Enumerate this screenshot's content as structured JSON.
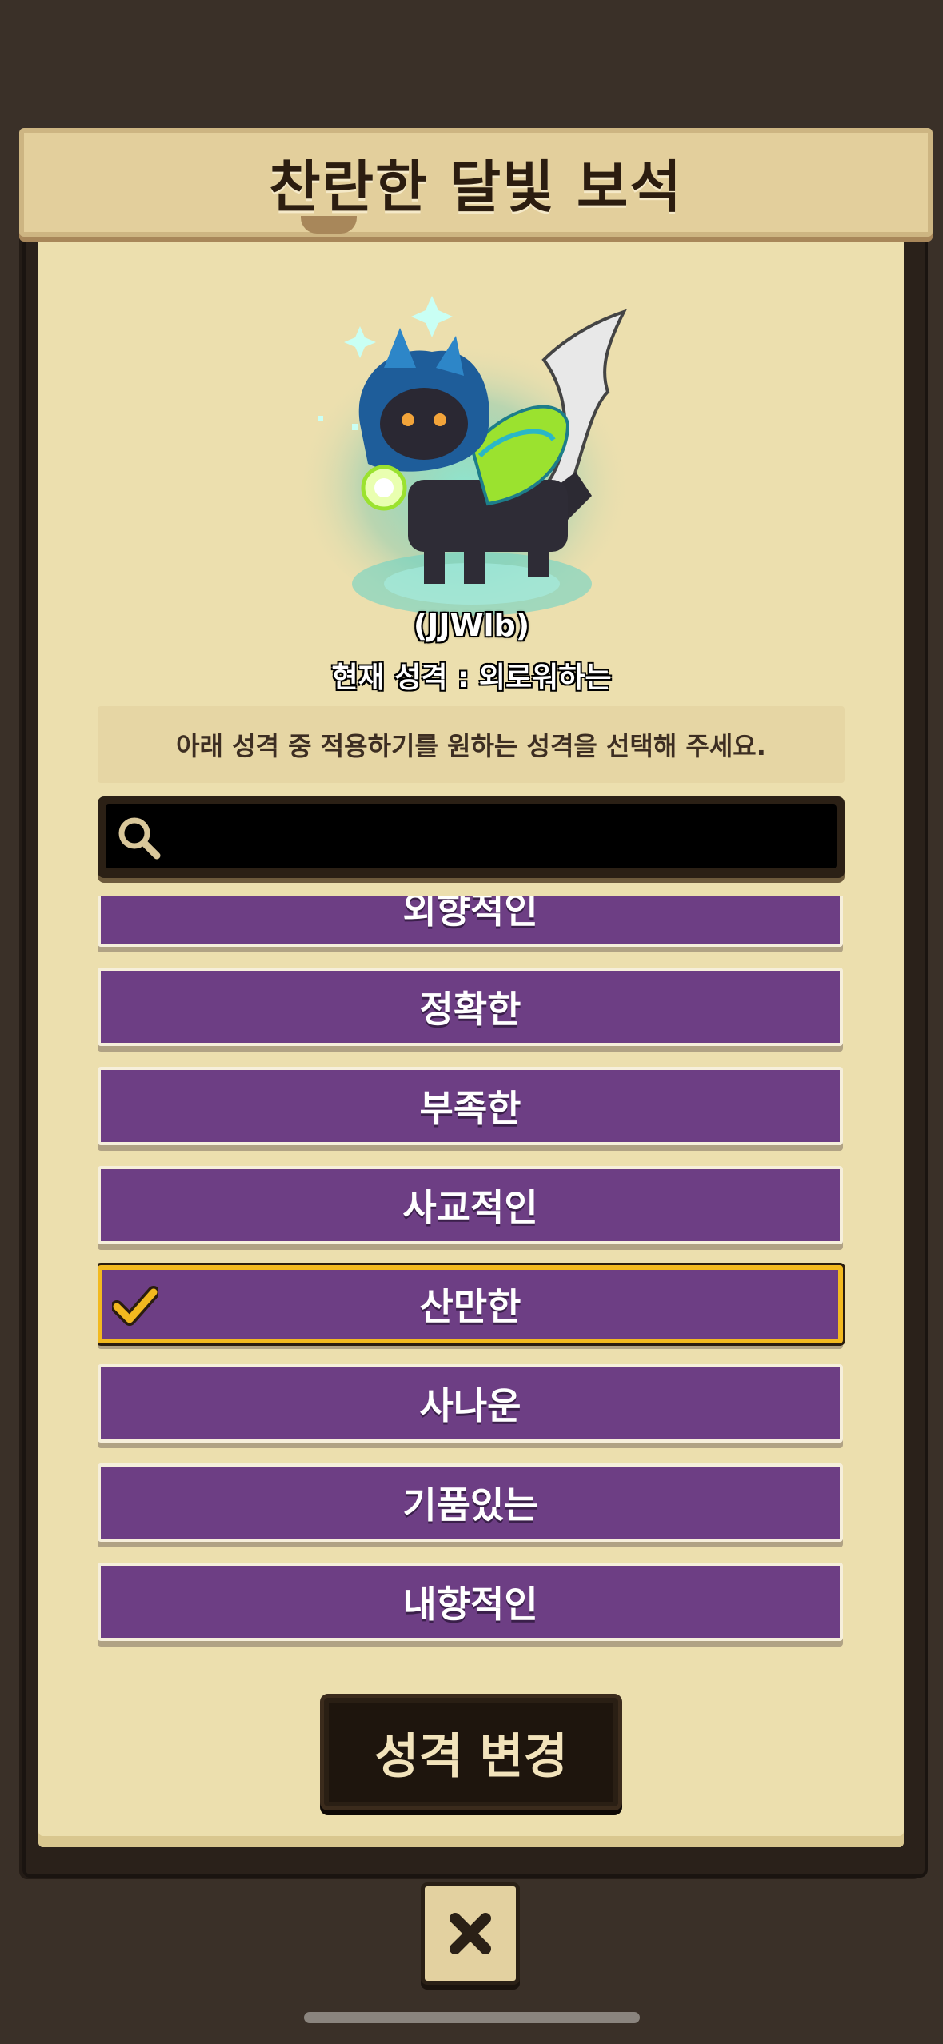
{
  "dialog": {
    "title": "찬란한 달빛 보석",
    "pet_name": "(JJWlb)",
    "current_personality": "현재 성격 : 외로워하는",
    "instruction": "아래 성격 중 적용하기를 원하는 성격을 선택해 주세요.",
    "search": {
      "placeholder": "",
      "value": ""
    },
    "options": [
      {
        "label": "외향적인",
        "selected": false
      },
      {
        "label": "정확한",
        "selected": false
      },
      {
        "label": "부족한",
        "selected": false
      },
      {
        "label": "사교적인",
        "selected": false
      },
      {
        "label": "산만한",
        "selected": true
      },
      {
        "label": "사나운",
        "selected": false
      },
      {
        "label": "기품있는",
        "selected": false
      },
      {
        "label": "내향적인",
        "selected": false
      }
    ],
    "confirm_label": "성격 변경",
    "icons": {
      "search": "search-icon",
      "check": "check-icon",
      "close": "close-icon"
    }
  },
  "colors": {
    "option_bg": "#6d3e84",
    "selected_border": "#f2b91f",
    "parchment": "#ecdfae"
  }
}
